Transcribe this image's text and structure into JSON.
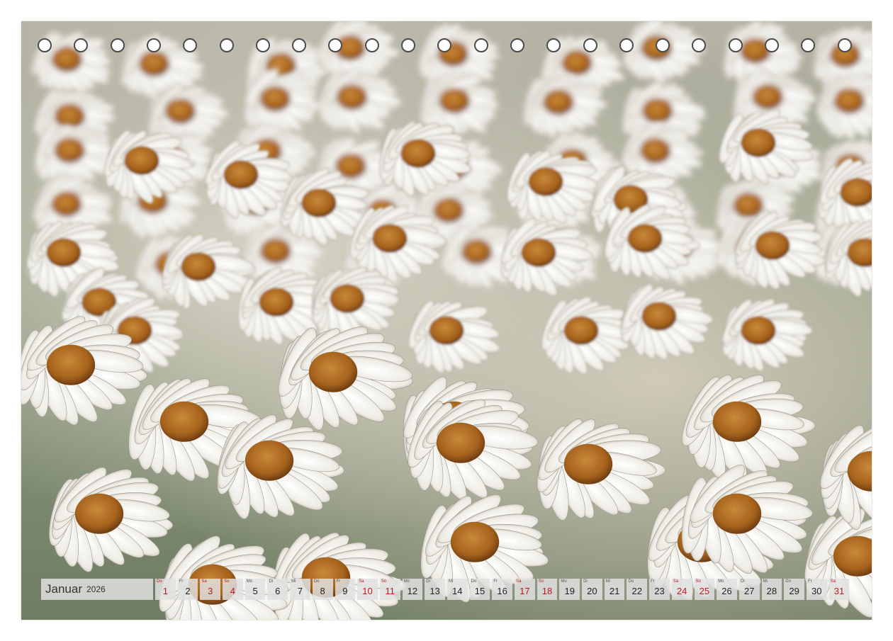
{
  "calendar": {
    "month": "Januar",
    "year": "2026",
    "days": [
      {
        "wd": "Do",
        "d": "1",
        "red": true
      },
      {
        "wd": "Fr",
        "d": "2",
        "red": false
      },
      {
        "wd": "Sa",
        "d": "3",
        "red": true
      },
      {
        "wd": "So",
        "d": "4",
        "red": true
      },
      {
        "wd": "Mo",
        "d": "5",
        "red": false
      },
      {
        "wd": "Di",
        "d": "6",
        "red": false
      },
      {
        "wd": "Mi",
        "d": "7",
        "red": false
      },
      {
        "wd": "Do",
        "d": "8",
        "red": false
      },
      {
        "wd": "Fr",
        "d": "9",
        "red": false
      },
      {
        "wd": "Sa",
        "d": "10",
        "red": true
      },
      {
        "wd": "So",
        "d": "11",
        "red": true
      },
      {
        "wd": "Mo",
        "d": "12",
        "red": false
      },
      {
        "wd": "Di",
        "d": "13",
        "red": false
      },
      {
        "wd": "Mi",
        "d": "14",
        "red": false
      },
      {
        "wd": "Do",
        "d": "15",
        "red": false
      },
      {
        "wd": "Fr",
        "d": "16",
        "red": false
      },
      {
        "wd": "Sa",
        "d": "17",
        "red": true
      },
      {
        "wd": "So",
        "d": "18",
        "red": true
      },
      {
        "wd": "Mo",
        "d": "19",
        "red": false
      },
      {
        "wd": "Di",
        "d": "20",
        "red": false
      },
      {
        "wd": "Mi",
        "d": "21",
        "red": false
      },
      {
        "wd": "Do",
        "d": "22",
        "red": false
      },
      {
        "wd": "Fr",
        "d": "23",
        "red": false
      },
      {
        "wd": "Sa",
        "d": "24",
        "red": true
      },
      {
        "wd": "So",
        "d": "25",
        "red": true
      },
      {
        "wd": "Mo",
        "d": "26",
        "red": false
      },
      {
        "wd": "Di",
        "d": "27",
        "red": false
      },
      {
        "wd": "Mi",
        "d": "28",
        "red": false
      },
      {
        "wd": "Do",
        "d": "29",
        "red": false
      },
      {
        "wd": "Fr",
        "d": "30",
        "red": false
      },
      {
        "wd": "Sa",
        "d": "31",
        "red": true
      }
    ]
  },
  "binding": {
    "hole_count": 23
  },
  "colors": {
    "weekend_red": "#c0161b",
    "petal_white": "#f4f3ee",
    "flower_center": "#a8661f"
  }
}
